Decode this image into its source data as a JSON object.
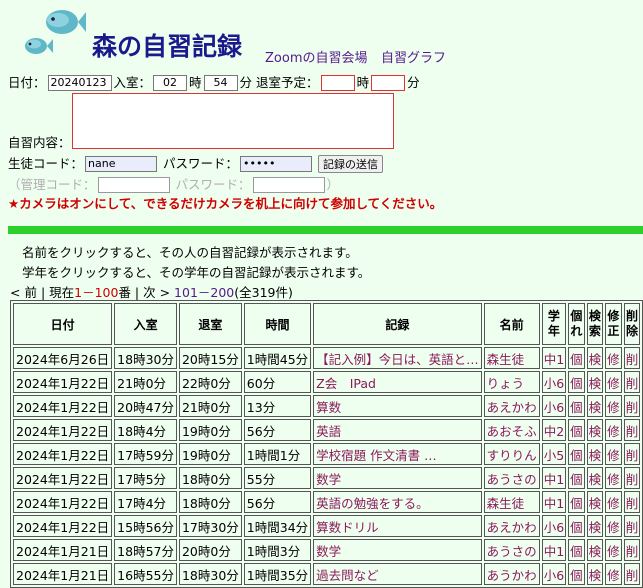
{
  "header": {
    "title": "森の自習記録",
    "links": [
      "Zoomの自習会場",
      "自習グラフ"
    ]
  },
  "form": {
    "date_label": "日付：",
    "date_value": "20240123",
    "entry_label": "入室：",
    "entry_hour": "02",
    "hour_unit": "時",
    "entry_min": "54",
    "min_unit": "分",
    "exit_label": "退室予定：",
    "exit_hour": "",
    "exit_min": "",
    "memo_label": "自習内容：",
    "student_code_label": "生徒コード：",
    "student_code_value": "nane",
    "password_label": "パスワード：",
    "password_value": "•••••",
    "submit_label": "記録の送信",
    "admin_code_label": "（管理コード：",
    "admin_password_label": "パスワード：",
    "admin_close": "）",
    "warning": "★カメラはオンにして、できるだけカメラを机上に向けて参加してください。"
  },
  "info": {
    "line1": "名前をクリックすると、その人の自習記録が表示されます。",
    "line2": "学年をクリックすると、その学年の自習記録が表示されます。"
  },
  "pager": {
    "prev_prefix": "< ",
    "prev": "前",
    "sep1": " | 現在",
    "current": "1－100",
    "sep2": "番 | 次 > ",
    "next": "101－200",
    "total": "(全319件)"
  },
  "table": {
    "headers": [
      "日付",
      "入室",
      "退室",
      "時間",
      "記録",
      "名前",
      "学年",
      "個れ",
      "検索",
      "修正",
      "削除"
    ],
    "rows": [
      {
        "date": "2024年6月26日",
        "in": "18時30分",
        "out": "20時15分",
        "dur": "1時間45分",
        "rec": "【記入例】今日は、英語と…",
        "name": "森生徒",
        "grade": "中1",
        "a": "個",
        "b": "検",
        "c": "修",
        "d": "削"
      },
      {
        "date": "2024年1月22日",
        "in": "21時0分",
        "out": "22時0分",
        "dur": "60分",
        "rec": "Z会　IPad",
        "name": "りょう",
        "grade": "小6",
        "a": "個",
        "b": "検",
        "c": "修",
        "d": "削"
      },
      {
        "date": "2024年1月22日",
        "in": "20時47分",
        "out": "21時0分",
        "dur": "13分",
        "rec": "算数",
        "name": "あえかわ",
        "grade": "小6",
        "a": "個",
        "b": "検",
        "c": "修",
        "d": "削"
      },
      {
        "date": "2024年1月22日",
        "in": "18時4分",
        "out": "19時0分",
        "dur": "56分",
        "rec": "英語",
        "name": "あおそふ",
        "grade": "中2",
        "a": "個",
        "b": "検",
        "c": "修",
        "d": "削"
      },
      {
        "date": "2024年1月22日",
        "in": "17時59分",
        "out": "19時0分",
        "dur": "1時間1分",
        "rec": "学校宿題 作文清書 …",
        "name": "すりりん",
        "grade": "小5",
        "a": "個",
        "b": "検",
        "c": "修",
        "d": "削"
      },
      {
        "date": "2024年1月22日",
        "in": "17時5分",
        "out": "18時0分",
        "dur": "55分",
        "rec": "数学",
        "name": "あうさの",
        "grade": "中1",
        "a": "個",
        "b": "検",
        "c": "修",
        "d": "削"
      },
      {
        "date": "2024年1月22日",
        "in": "17時4分",
        "out": "18時0分",
        "dur": "56分",
        "rec": "英語の勉強をする。",
        "name": "森生徒",
        "grade": "中1",
        "a": "個",
        "b": "検",
        "c": "修",
        "d": "削"
      },
      {
        "date": "2024年1月22日",
        "in": "15時56分",
        "out": "17時30分",
        "dur": "1時間34分",
        "rec": "算数ドリル",
        "name": "あえかわ",
        "grade": "小6",
        "a": "個",
        "b": "検",
        "c": "修",
        "d": "削"
      },
      {
        "date": "2024年1月21日",
        "in": "18時57分",
        "out": "20時0分",
        "dur": "1時間3分",
        "rec": "数学",
        "name": "あうさの",
        "grade": "中1",
        "a": "個",
        "b": "検",
        "c": "修",
        "d": "削"
      },
      {
        "date": "2024年1月21日",
        "in": "16時55分",
        "out": "18時30分",
        "dur": "1時間35分",
        "rec": "過去問など",
        "name": "あうかわ",
        "grade": "小6",
        "a": "個",
        "b": "検",
        "c": "修",
        "d": "削"
      }
    ]
  }
}
